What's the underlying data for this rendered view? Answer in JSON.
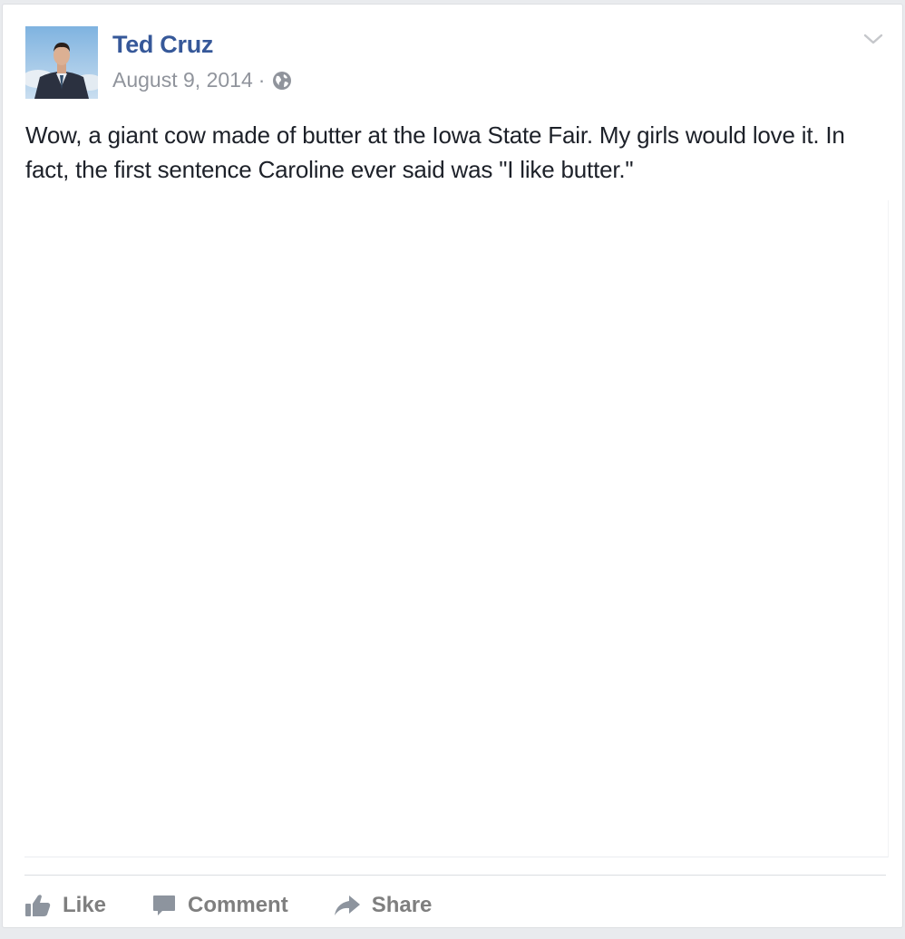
{
  "post": {
    "author": "Ted Cruz",
    "date": "August 9, 2014",
    "separator": "·",
    "privacy_icon": "globe-icon",
    "options_icon": "chevron-down-icon",
    "text": "Wow, a giant cow made of butter at the Iowa State Fair. My girls would love it. In fact, the first sentence Caroline ever said was \"I like butter.\""
  },
  "actions": {
    "like_label": "Like",
    "comment_label": "Comment",
    "share_label": "Share"
  },
  "colors": {
    "author_link": "#365899",
    "meta_text": "#90949c",
    "body_text": "#1d2129",
    "action_text": "#7f7f7f"
  }
}
